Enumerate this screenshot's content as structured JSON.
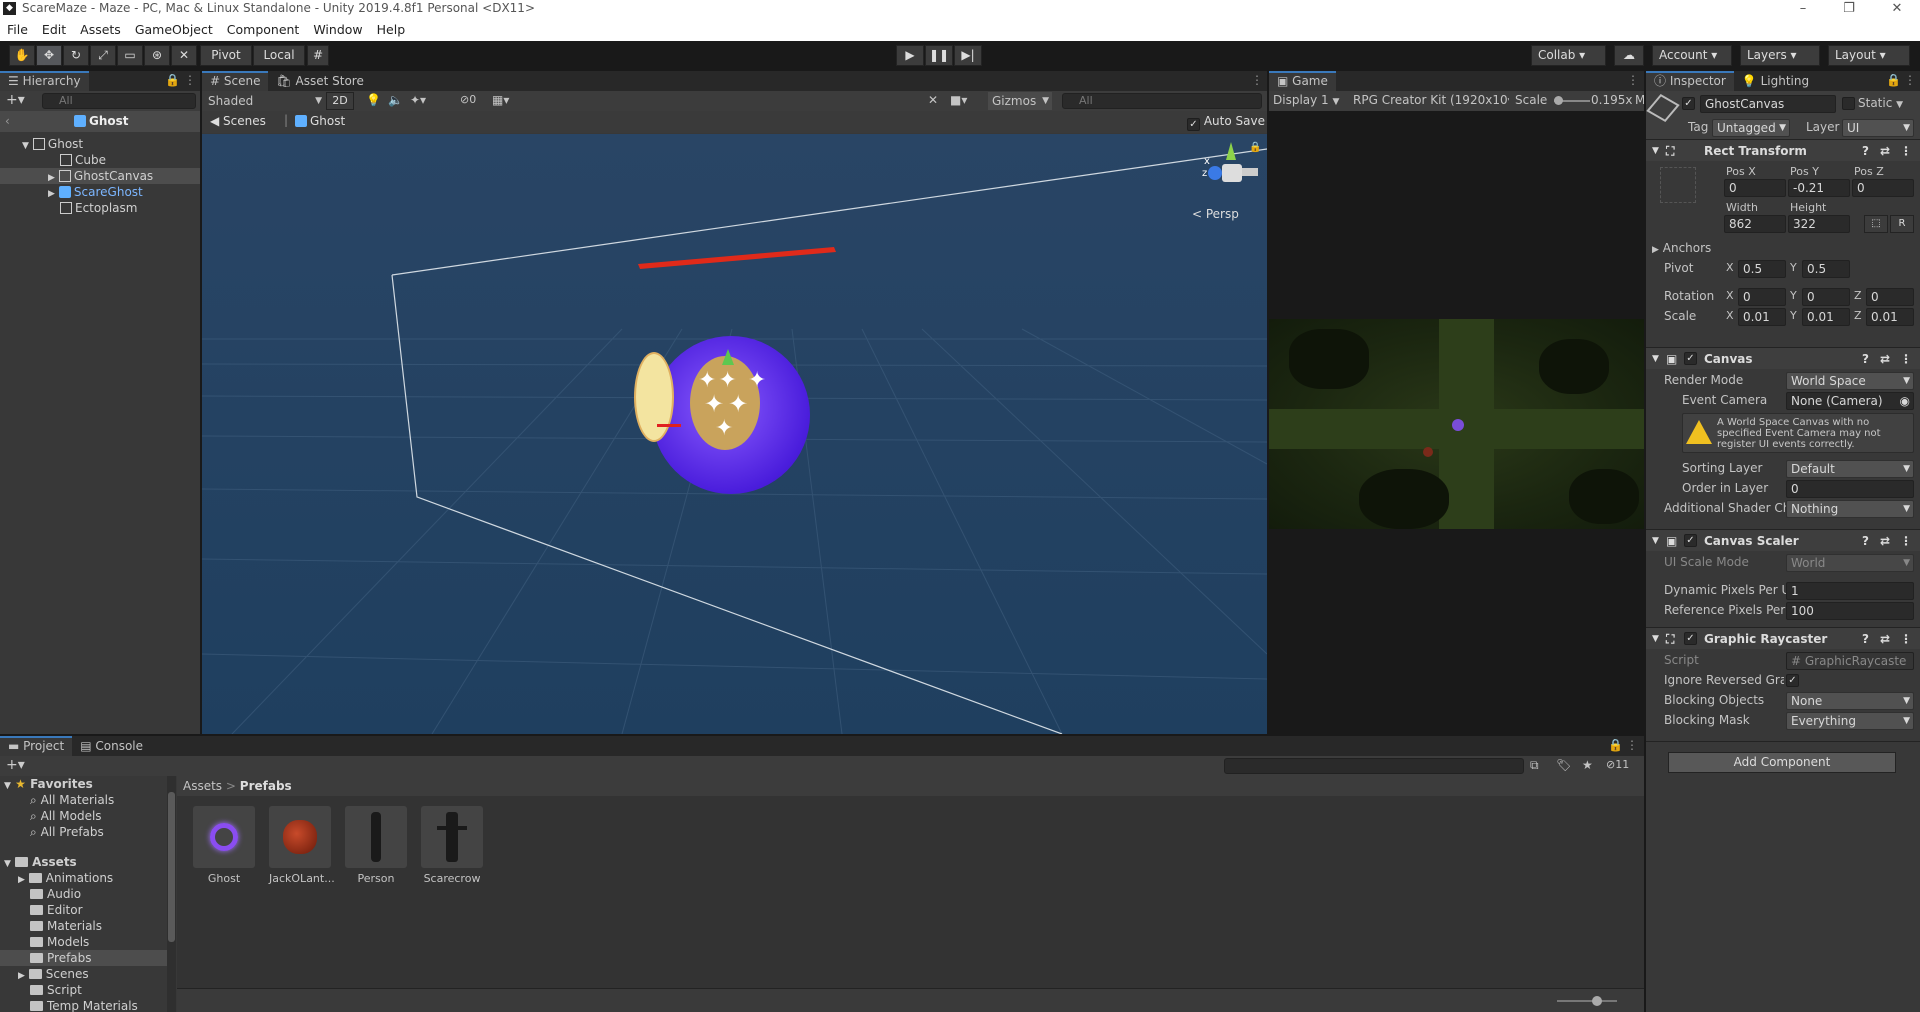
{
  "window": {
    "title": "ScareMaze - Maze - PC, Mac & Linux Standalone - Unity 2019.4.8f1 Personal <DX11>",
    "minimize": "–",
    "maximize": "❐",
    "close": "✕"
  },
  "menu": [
    "File",
    "Edit",
    "Assets",
    "GameObject",
    "Component",
    "Window",
    "Help"
  ],
  "toolbar": {
    "pivot": "Pivot",
    "local": "Local",
    "collab": "Collab ▾",
    "account": "Account",
    "layers": "Layers",
    "layout": "Layout"
  },
  "hierarchy": {
    "tab": "Hierarchy",
    "search_placeholder": "All",
    "context": "Ghost",
    "items": [
      {
        "label": "Ghost",
        "depth": 0
      },
      {
        "label": "Cube",
        "depth": 1
      },
      {
        "label": "GhostCanvas",
        "depth": 1
      },
      {
        "label": "ScareGhost",
        "depth": 1
      },
      {
        "label": "Ectoplasm",
        "depth": 1
      }
    ]
  },
  "scene": {
    "tab_scene": "Scene",
    "tab_store": "Asset Store",
    "shading": "Shaded",
    "mode2d": "2D",
    "hidden_count": "0",
    "gizmos": "Gizmos",
    "search_placeholder": "All",
    "breadcrumb_root": "Scenes",
    "breadcrumb_item": "Ghost",
    "auto_save": "Auto Save",
    "persp": "< Persp",
    "gizmo_x": "x",
    "gizmo_z": "z"
  },
  "game": {
    "tab": "Game",
    "display": "Display 1",
    "resolution": "RPG Creator Kit (1920x10",
    "scale_label": "Scale",
    "scale_value": "0.195x",
    "extra": "M"
  },
  "inspector": {
    "tab": "Inspector",
    "tab_lighting": "Lighting",
    "object_name": "GhostCanvas",
    "static": "Static",
    "tag_label": "Tag",
    "tag": "Untagged",
    "layer_label": "Layer",
    "layer": "UI",
    "rect": {
      "title": "Rect Transform",
      "posx_label": "Pos X",
      "posy_label": "Pos Y",
      "posz_label": "Pos Z",
      "posx": "0",
      "posy": "-0.21",
      "posz": "0",
      "width_label": "Width",
      "height_label": "Height",
      "width": "862",
      "height": "322",
      "r_btn": "R",
      "anchors": "Anchors",
      "pivot_label": "Pivot",
      "pivot_x": "0.5",
      "pivot_y": "0.5",
      "rotation_label": "Rotation",
      "rot_x": "0",
      "rot_y": "0",
      "rot_z": "0",
      "scale_label": "Scale",
      "scale_x": "0.01",
      "scale_y": "0.01",
      "scale_z": "0.01",
      "x": "X",
      "y": "Y",
      "z": "Z"
    },
    "canvas": {
      "title": "Canvas",
      "render_mode_label": "Render Mode",
      "render_mode": "World Space",
      "event_camera_label": "Event Camera",
      "event_camera": "None (Camera)",
      "warning": "A World Space Canvas with no specified Event Camera may not register UI events correctly.",
      "sorting_layer_label": "Sorting Layer",
      "sorting_layer": "Default",
      "order_label": "Order in Layer",
      "order": "0",
      "shader_label": "Additional Shader Ch",
      "shader": "Nothing"
    },
    "scaler": {
      "title": "Canvas Scaler",
      "scale_mode_label": "UI Scale Mode",
      "scale_mode": "World",
      "dynamic_label": "Dynamic Pixels Per U",
      "dynamic": "1",
      "reference_label": "Reference Pixels Per",
      "reference": "100"
    },
    "raycaster": {
      "title": "Graphic Raycaster",
      "script_label": "Script",
      "script": "GraphicRaycaste",
      "ignore_label": "Ignore Reversed Grap",
      "blocking_label": "Blocking Objects",
      "blocking": "None",
      "mask_label": "Blocking Mask",
      "mask": "Everything"
    },
    "add_component": "Add Component"
  },
  "project": {
    "tab": "Project",
    "tab_console": "Console",
    "hidden_count": "11",
    "favorites": "Favorites",
    "fav_items": [
      "All Materials",
      "All Models",
      "All Prefabs"
    ],
    "assets": "Assets",
    "folders": [
      "Animations",
      "Audio",
      "Editor",
      "Materials",
      "Models",
      "Prefabs",
      "Scenes",
      "Script",
      "Temp Materials"
    ],
    "breadcrumb_root": "Assets",
    "breadcrumb_sep": ">",
    "breadcrumb_item": "Prefabs",
    "prefabs": [
      "Ghost",
      "JackOLant...",
      "Person",
      "Scarecrow"
    ]
  },
  "colors": {
    "accent": "#3a79bb",
    "scene_sky": "#21415f",
    "ghost": "#7a3df0"
  }
}
